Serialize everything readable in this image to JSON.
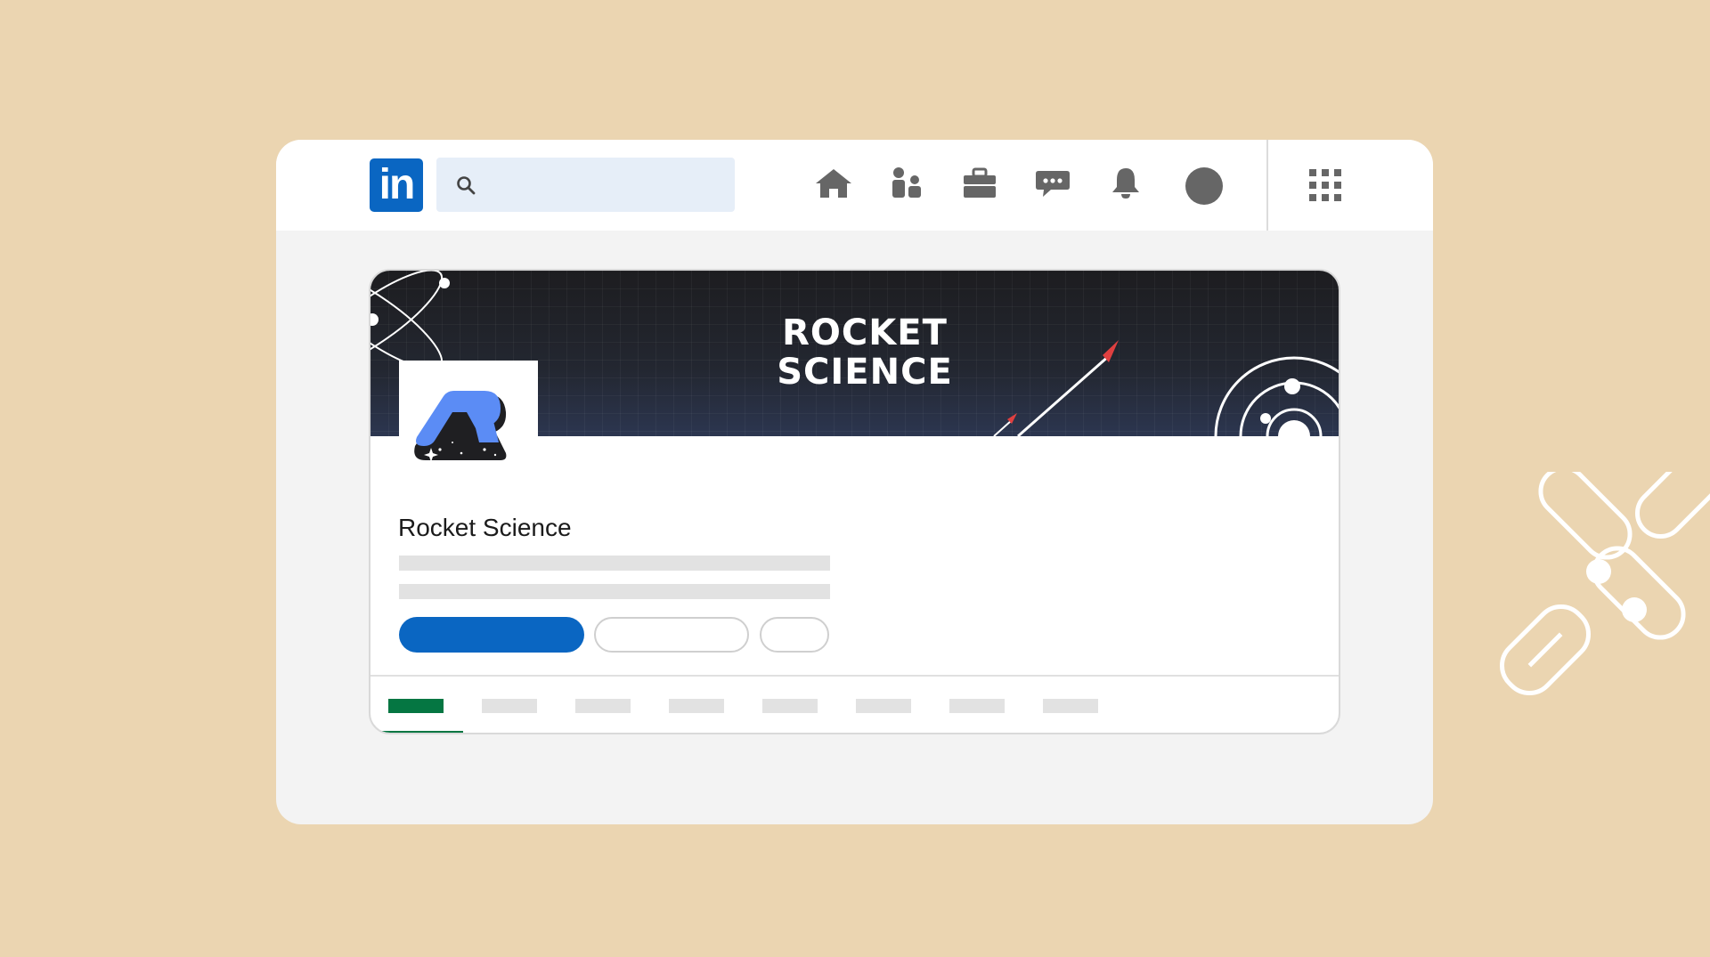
{
  "app": {
    "logo_text": "in",
    "brand_color": "#0a66c2"
  },
  "search": {
    "placeholder": "",
    "icon": "search-icon"
  },
  "nav": {
    "icons": [
      "home-icon",
      "network-icon",
      "jobs-icon",
      "messaging-icon",
      "notifications-icon",
      "avatar",
      "apps-grid-icon"
    ]
  },
  "company": {
    "banner_line1": "ROCKET",
    "banner_line2": "SCIENCE",
    "name": "Rocket Science",
    "accent_color": "#5b8cf5"
  },
  "tabs": {
    "active_color": "#057642",
    "active_index": 0
  }
}
